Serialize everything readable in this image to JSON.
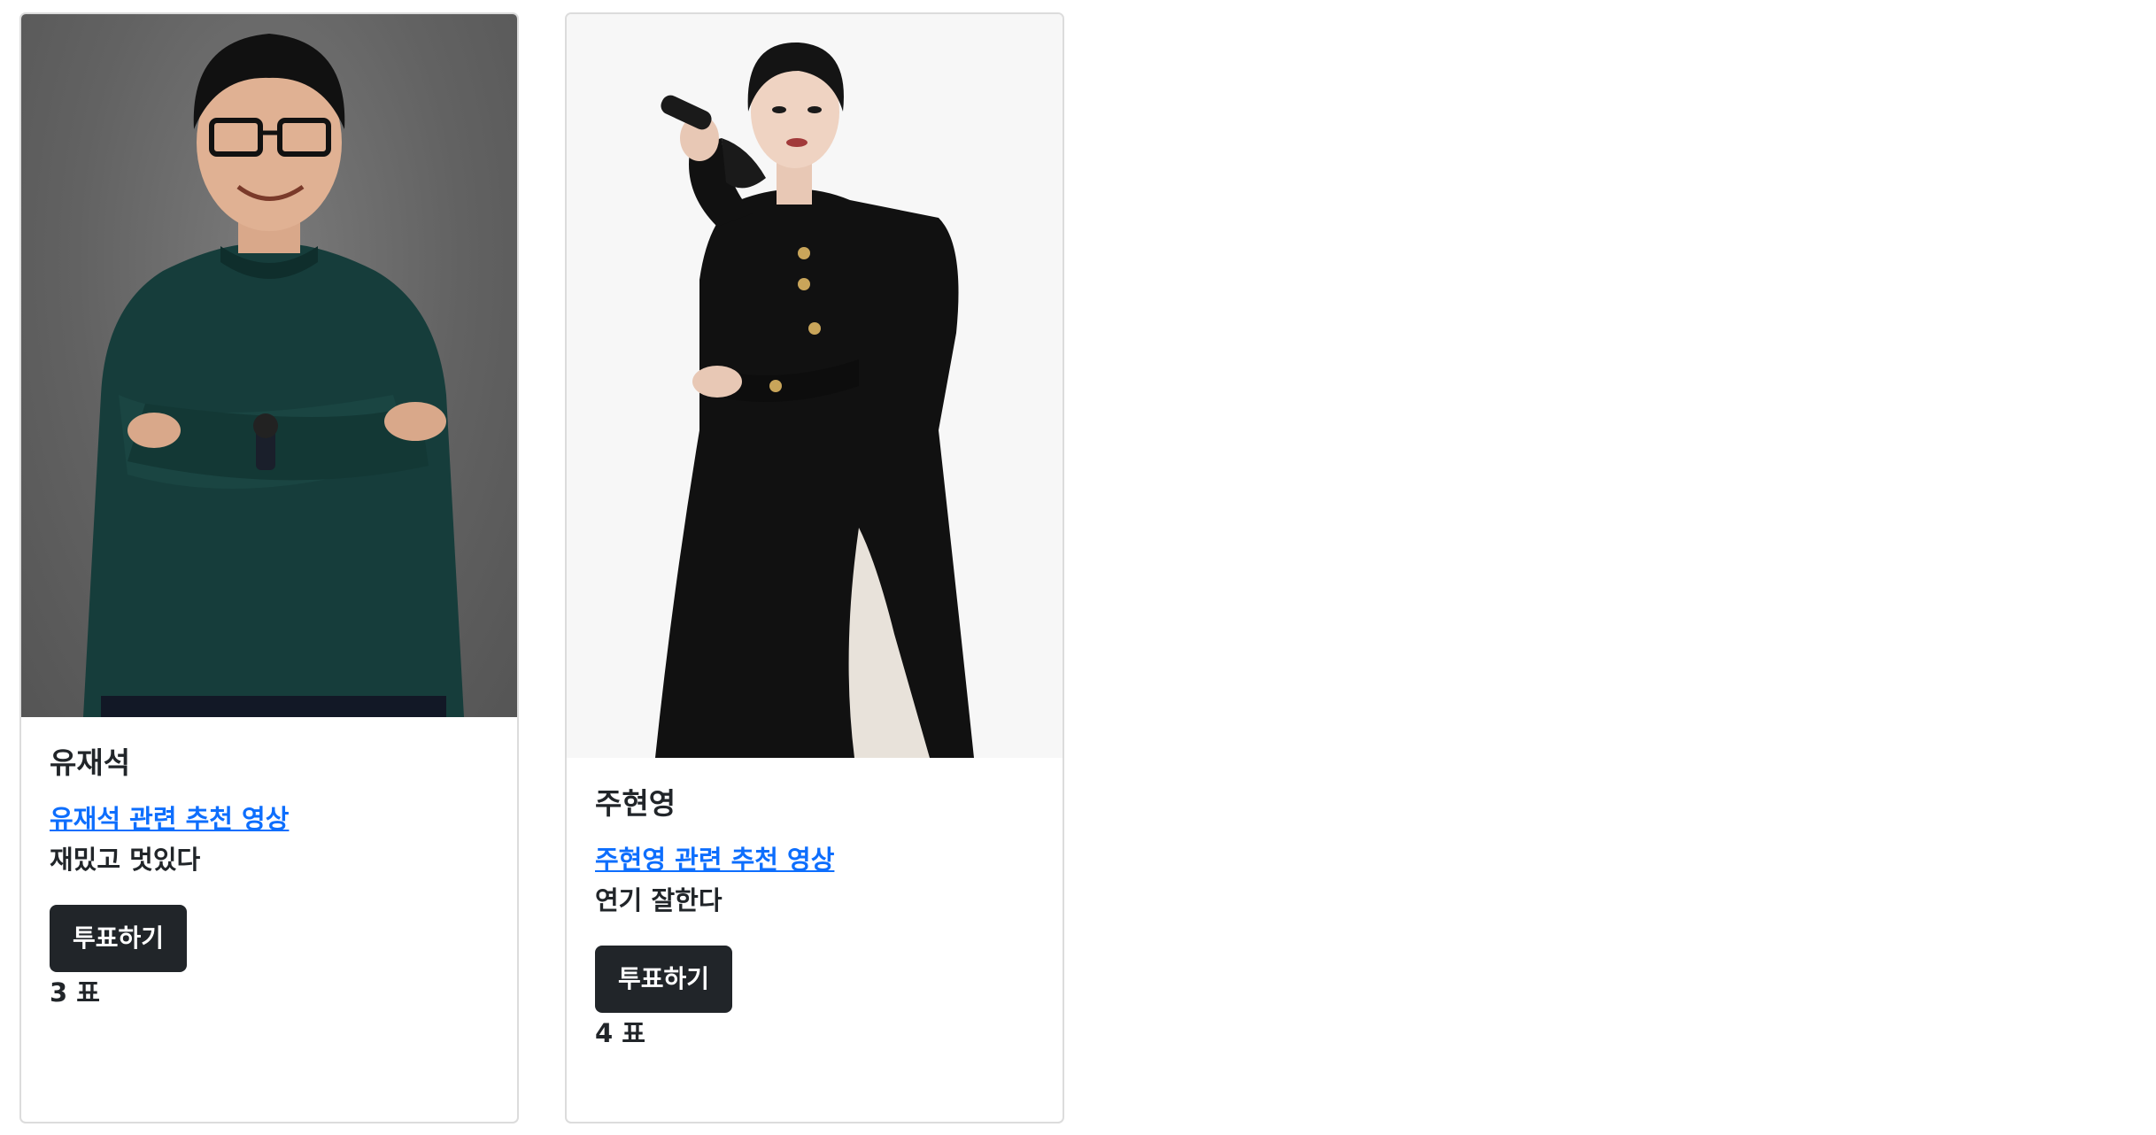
{
  "candidates": [
    {
      "name": "유재석",
      "link_label": "유재석 관련 추천 영상",
      "description": "재밌고 멋있다",
      "vote_button_label": "투표하기",
      "votes": "3 표"
    },
    {
      "name": "주현영",
      "link_label": "주현영 관련 추천 영상",
      "description": "연기 잘한다",
      "vote_button_label": "투표하기",
      "votes": "4 표"
    }
  ],
  "colors": {
    "link": "#0d6efd",
    "button_bg": "#212529",
    "button_text": "#ffffff",
    "card_border": "#dcdcdc"
  }
}
